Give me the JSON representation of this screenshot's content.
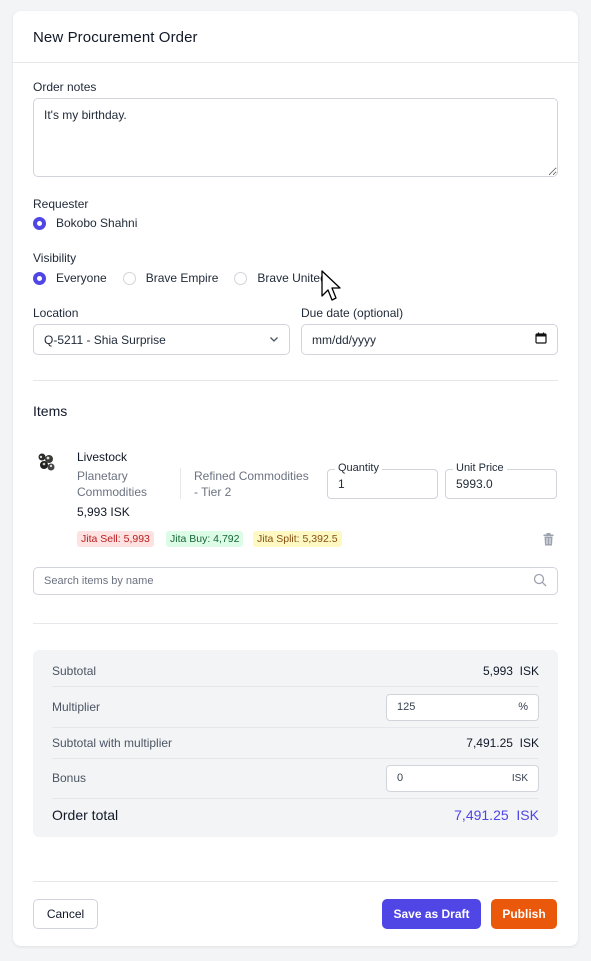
{
  "header": {
    "title": "New Procurement Order"
  },
  "notes": {
    "label": "Order notes",
    "value": "It's my birthday."
  },
  "requester": {
    "label": "Requester",
    "options": [
      "Bokobo Shahni"
    ],
    "selected": "Bokobo Shahni"
  },
  "visibility": {
    "label": "Visibility",
    "options": [
      "Everyone",
      "Brave Empire",
      "Brave United"
    ],
    "selected": "Everyone"
  },
  "location": {
    "label": "Location",
    "value": "Q-5211 - Shia Surprise"
  },
  "due_date": {
    "label": "Due date (optional)",
    "placeholder": "mm/dd/yyyy"
  },
  "items": {
    "title": "Items",
    "list": [
      {
        "name": "Livestock",
        "category_line1": "Planetary",
        "category_line2": "Commodities",
        "group_line1": "Refined Commodities",
        "group_line2": "- Tier 2",
        "price": "5,993 ISK",
        "quantity_label": "Quantity",
        "quantity": "1",
        "unit_price_label": "Unit Price",
        "unit_price": "5993.0",
        "jita_sell": "Jita Sell: 5,993",
        "jita_buy": "Jita Buy: 4,792",
        "jita_split": "Jita Split: 5,392.5"
      }
    ],
    "search_placeholder": "Search items by name"
  },
  "summary": {
    "subtotal_label": "Subtotal",
    "subtotal_value": "5,993",
    "subtotal_unit": "ISK",
    "multiplier_label": "Multiplier",
    "multiplier_value": "125",
    "multiplier_unit": "%",
    "subtotal_mult_label": "Subtotal with multiplier",
    "subtotal_mult_value": "7,491.25",
    "subtotal_mult_unit": "ISK",
    "bonus_label": "Bonus",
    "bonus_value": "0",
    "bonus_unit": "ISK",
    "total_label": "Order total",
    "total_value": "7,491.25",
    "total_unit": "ISK"
  },
  "footer": {
    "cancel": "Cancel",
    "save_draft": "Save as Draft",
    "publish": "Publish"
  },
  "colors": {
    "accent": "#4f46e5",
    "publish": "#ea580c",
    "sell_bg": "#fee2e2",
    "buy_bg": "#dcfce7",
    "split_bg": "#fef9c3"
  },
  "icons": [
    "livestock-item-icon",
    "chevron-down-icon",
    "calendar-icon",
    "trash-icon",
    "search-icon",
    "cursor-icon"
  ]
}
